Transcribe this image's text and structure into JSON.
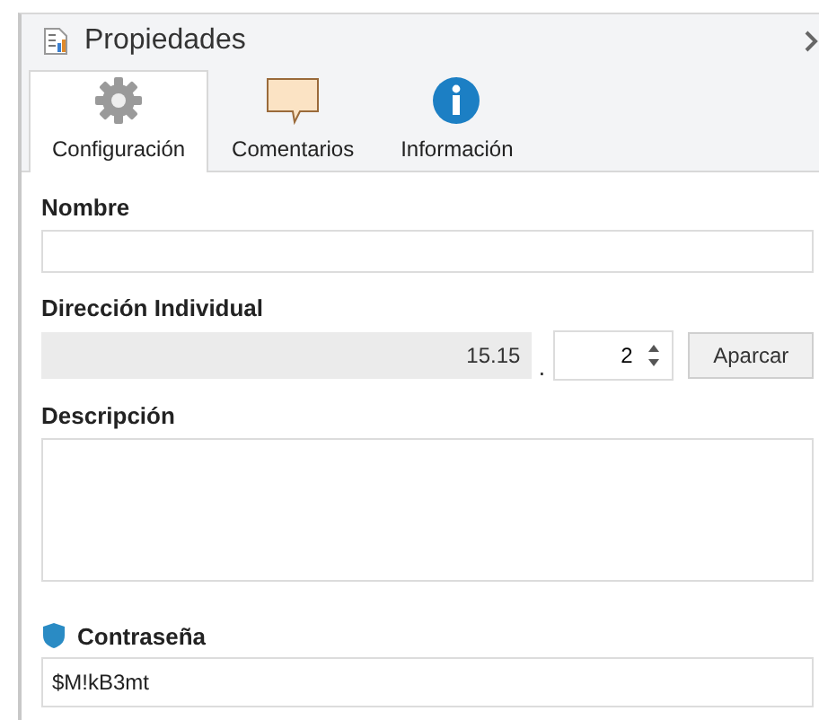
{
  "panel": {
    "title": "Propiedades"
  },
  "tabs": [
    {
      "label": "Configuración",
      "kind": "gear",
      "selected": true
    },
    {
      "label": "Comentarios",
      "kind": "comment",
      "selected": false
    },
    {
      "label": "Información",
      "kind": "info",
      "selected": false
    }
  ],
  "name_field": {
    "label": "Nombre"
  },
  "address": {
    "label": "Dirección Individual",
    "prefix": "15.15",
    "separator": ".",
    "value": "2",
    "button": "Aparcar"
  },
  "description": {
    "label": "Descripción"
  },
  "password": {
    "label": "Contraseña",
    "value": "$M!kB3mt"
  }
}
